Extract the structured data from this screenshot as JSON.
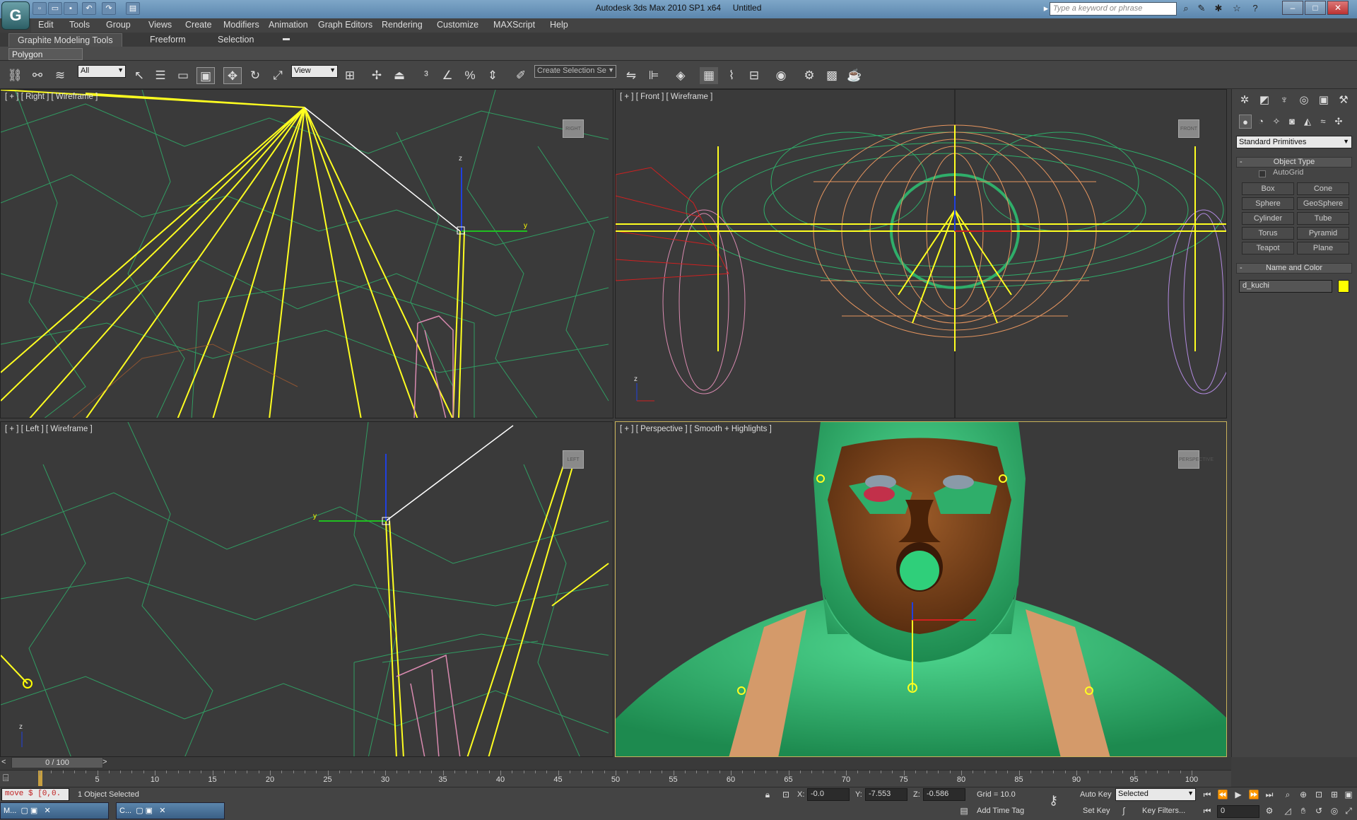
{
  "app": {
    "title": "Autodesk 3ds Max 2010 SP1 x64",
    "document": "Untitled",
    "logo": "G",
    "search_placeholder": "Type a keyword or phrase"
  },
  "quick_access": [
    "new-file-icon",
    "open-folder-icon",
    "save-icon",
    "undo-icon",
    "redo-icon",
    "project-folder-icon"
  ],
  "window_controls": {
    "minimize": "–",
    "maximize": "□",
    "close": "✕"
  },
  "menus": [
    "Edit",
    "Tools",
    "Group",
    "Views",
    "Create",
    "Modifiers",
    "Animation",
    "Graph Editors",
    "Rendering",
    "Customize",
    "MAXScript",
    "Help"
  ],
  "ribbon": {
    "tabs": [
      "Graphite Modeling Tools",
      "Freeform",
      "Selection"
    ],
    "active_tab": 0,
    "subtab": "Polygon Modeling"
  },
  "toolbar": {
    "selection_filter": "All",
    "ref_coord": "View",
    "named_selection": "Create Selection Se"
  },
  "viewports": {
    "top_left": {
      "label": "[ + ] [ Right ] [ Wireframe ]",
      "cube": "RIGHT"
    },
    "top_right": {
      "label": "[ + ] [ Front ] [ Wireframe ]",
      "cube": "FRONT"
    },
    "bottom_left": {
      "label": "[ + ] [ Left ] [ Wireframe ]",
      "cube": "LEFT"
    },
    "bottom_right": {
      "label": "[ + ] [ Perspective ] [ Smooth + Highlights ]",
      "cube": "PERSPECTIVE"
    },
    "axis": {
      "x": "x",
      "y": "y",
      "z": "z"
    }
  },
  "command_panel": {
    "category": "Standard Primitives",
    "object_type": {
      "title": "Object Type",
      "autogrid": "AutoGrid",
      "buttons": [
        "Box",
        "Cone",
        "Sphere",
        "GeoSphere",
        "Cylinder",
        "Tube",
        "Torus",
        "Pyramid",
        "Teapot",
        "Plane"
      ]
    },
    "name_color": {
      "title": "Name and Color",
      "name": "d_kuchi",
      "color": "#ffff00"
    },
    "rollout_toggle": "-"
  },
  "timeline": {
    "frame_display": "0 / 100",
    "ticks": [
      5,
      10,
      15,
      20,
      25,
      30,
      35,
      40,
      45,
      50,
      55,
      60,
      65,
      70,
      75,
      80,
      85,
      90,
      95,
      100
    ],
    "left_arrow": "<",
    "right_arrow": ">"
  },
  "status": {
    "maxscript": "move $ [0,0.",
    "selection": "1 Object Selected",
    "x_label": "X:",
    "x_value": "-0.0",
    "y_label": "Y:",
    "y_value": "-7.553",
    "z_label": "Z:",
    "z_value": "-0.586",
    "grid": "Grid = 10.0",
    "auto_key": "Auto Key",
    "set_key": "Set Key",
    "selected": "Selected",
    "key_filters": "Key Filters...",
    "add_time_tag": "Add Time Tag",
    "current_frame": "0"
  },
  "taskbar": [
    "M...",
    "C..."
  ]
}
